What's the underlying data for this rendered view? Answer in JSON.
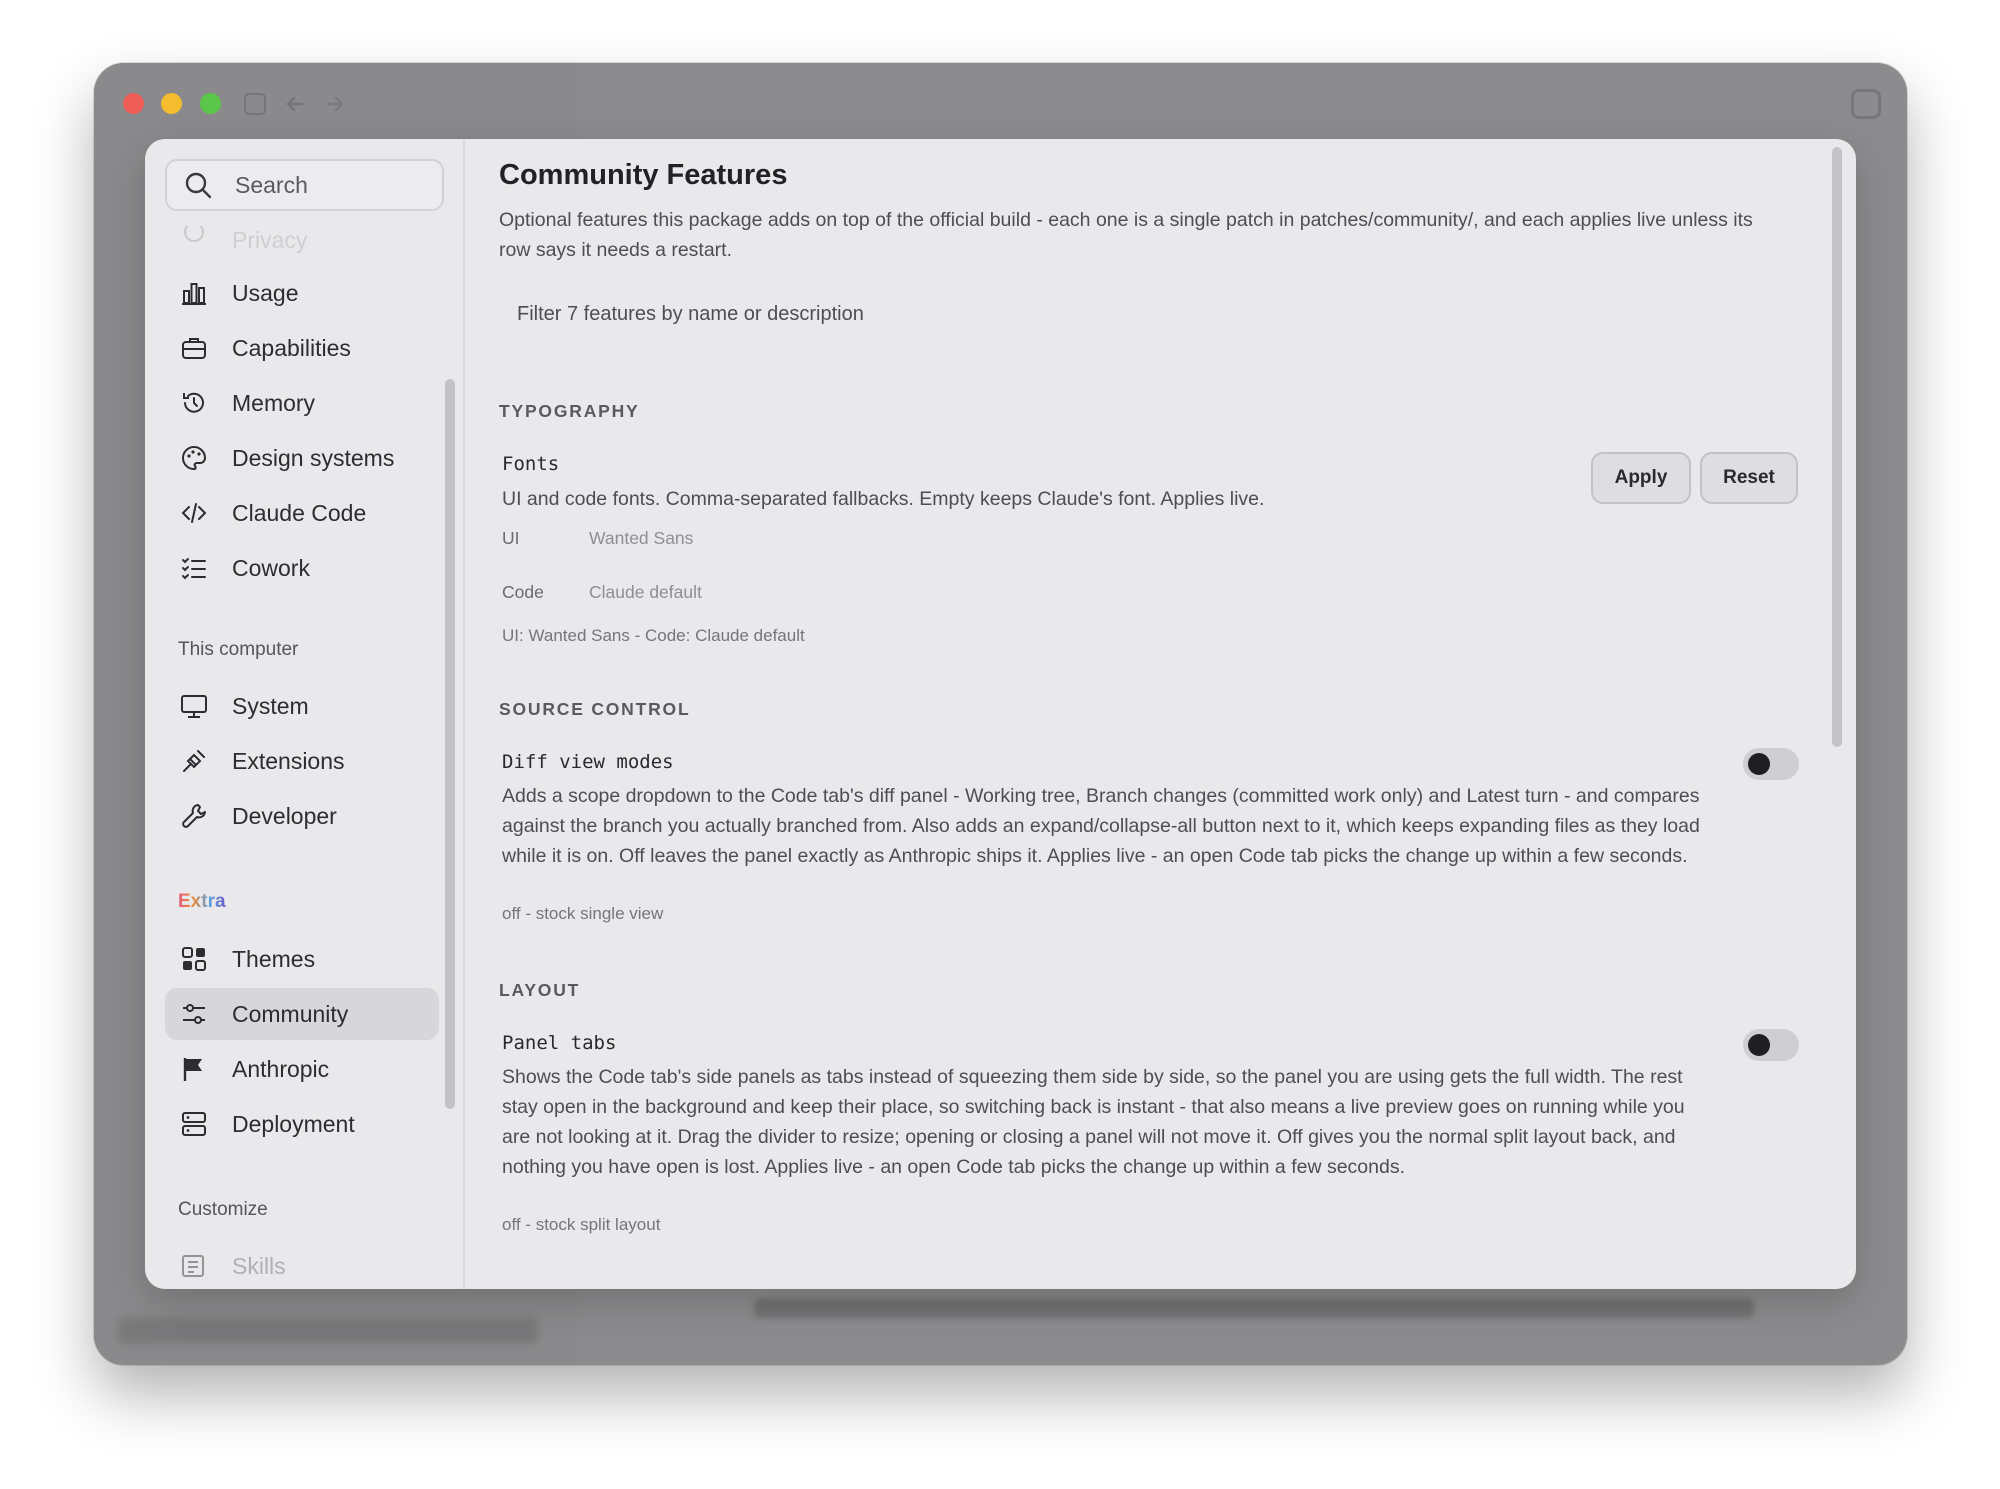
{
  "sidebar": {
    "search_placeholder": "Search",
    "items_top": [
      {
        "label": "Privacy",
        "icon": "shield-icon"
      },
      {
        "label": "Usage",
        "icon": "bar-chart-icon"
      },
      {
        "label": "Capabilities",
        "icon": "briefcase-icon"
      },
      {
        "label": "Memory",
        "icon": "history-icon"
      },
      {
        "label": "Design systems",
        "icon": "palette-icon"
      },
      {
        "label": "Claude Code",
        "icon": "code-icon"
      },
      {
        "label": "Cowork",
        "icon": "checklist-icon"
      }
    ],
    "section_this_computer": "This computer",
    "items_computer": [
      {
        "label": "System",
        "icon": "monitor-icon"
      },
      {
        "label": "Extensions",
        "icon": "puzzle-icon"
      },
      {
        "label": "Developer",
        "icon": "wrench-icon"
      }
    ],
    "section_extra": "Extra",
    "items_extra": [
      {
        "label": "Themes",
        "icon": "grid-icon"
      },
      {
        "label": "Community",
        "icon": "sliders-icon",
        "active": true
      },
      {
        "label": "Anthropic",
        "icon": "flag-icon"
      },
      {
        "label": "Deployment",
        "icon": "server-icon"
      }
    ],
    "section_customize": "Customize",
    "items_customize": [
      {
        "label": "Skills",
        "icon": "skills-icon"
      }
    ]
  },
  "main": {
    "title": "Community Features",
    "description": "Optional features this package adds on top of the official build - each one is a single patch in patches/community/, and each applies live unless its row says it needs a restart.",
    "filter_placeholder": "Filter 7 features by name or description",
    "sections": [
      {
        "heading": "TYPOGRAPHY",
        "feature": {
          "name": "Fonts",
          "description": "UI and code fonts. Comma-separated fallbacks. Empty keeps Claude's font. Applies live.",
          "apply_label": "Apply",
          "reset_label": "Reset",
          "ui_label": "UI",
          "ui_value": "Wanted Sans",
          "code_label": "Code",
          "code_value": "Claude default",
          "summary": "UI: Wanted Sans - Code: Claude default"
        }
      },
      {
        "heading": "SOURCE CONTROL",
        "feature": {
          "name": "Diff view modes",
          "description": "Adds a scope dropdown to the Code tab's diff panel - Working tree, Branch changes (committed work only) and Latest turn - and compares against the branch you actually branched from. Also adds an expand/collapse-all button next to it, which keeps expanding files as they load while it is on. Off leaves the panel exactly as Anthropic ships it. Applies live - an open Code tab picks the change up within a few seconds.",
          "status": "off - stock single view",
          "enabled": false
        }
      },
      {
        "heading": "LAYOUT",
        "feature": {
          "name": "Panel tabs",
          "description": "Shows the Code tab's side panels as tabs instead of squeezing them side by side, so the panel you are using gets the full width. The rest stay open in the background and keep their place, so switching back is instant - that also means a live preview goes on running while you are not looking at it. Drag the divider to resize; opening or closing a panel will not move it. Off gives you the normal split layout back, and nothing you have open is lost. Applies live - an open Code tab picks the change up within a few seconds.",
          "status": "off - stock split layout",
          "enabled": false
        }
      }
    ]
  },
  "colors": {
    "window_chrome": "#8c8c8e",
    "dialog_bg": "#e9e9eb",
    "active_item": "#d7d7da",
    "toggle_track": "#cfcfd3",
    "toggle_knob": "#1f1f22"
  }
}
